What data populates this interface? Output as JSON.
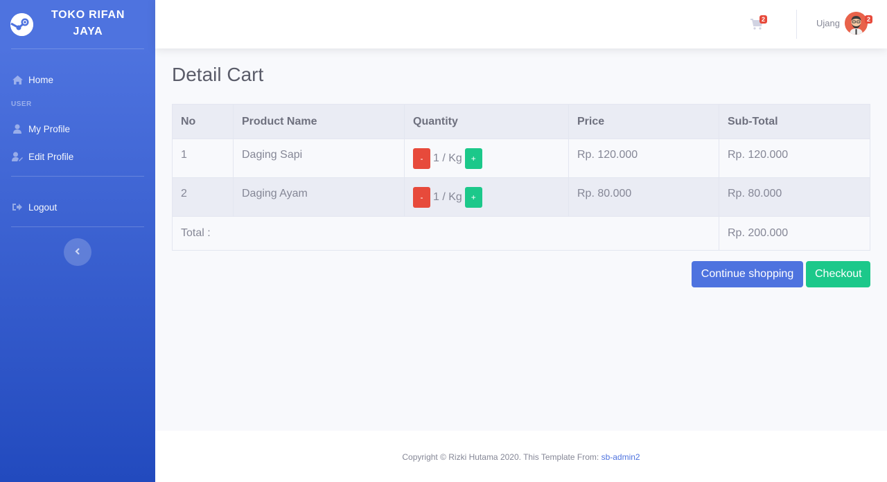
{
  "brand": {
    "name": "TOKO RIFAN JAYA"
  },
  "sidebar": {
    "items": [
      {
        "label": "Home",
        "icon": "home-icon"
      },
      {
        "label": "My Profile",
        "icon": "user-icon"
      },
      {
        "label": "Edit Profile",
        "icon": "user-edit-icon"
      },
      {
        "label": "Logout",
        "icon": "logout-icon"
      }
    ],
    "heading_user": "USER",
    "toggle_icon": "chevron-left-icon"
  },
  "topbar": {
    "cart_badge": "2",
    "user_name": "Ujang",
    "avatar_badge": "2"
  },
  "page": {
    "title": "Detail Cart"
  },
  "cart": {
    "columns": [
      "No",
      "Product Name",
      "Quantity",
      "Price",
      "Sub-Total"
    ],
    "rows": [
      {
        "no": "1",
        "product": "Daging Sapi",
        "qty": "1 / Kg",
        "price": "Rp. 120.000",
        "subtotal": "Rp. 120.000"
      },
      {
        "no": "2",
        "product": "Daging Ayam",
        "qty": "1 / Kg",
        "price": "Rp. 80.000",
        "subtotal": "Rp. 80.000"
      }
    ],
    "minus_label": "-",
    "plus_label": "+",
    "total_label": "Total :",
    "total_value": "Rp. 200.000"
  },
  "actions": {
    "continue": "Continue shopping",
    "checkout": "Checkout"
  },
  "footer": {
    "text": "Copyright © Rizki Hutama 2020. This Template From: ",
    "link": "sb-admin2"
  },
  "colors": {
    "primary": "#4e73df",
    "danger": "#e74a3b",
    "success": "#1cc88a"
  }
}
